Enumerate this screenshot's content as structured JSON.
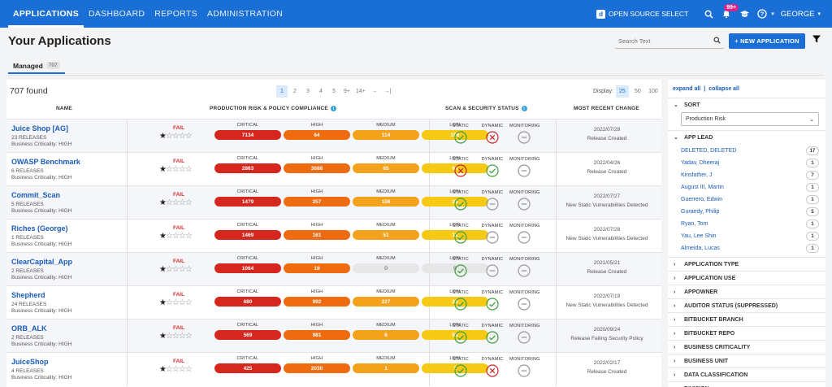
{
  "nav": {
    "items": [
      "APPLICATIONS",
      "DASHBOARD",
      "REPORTS",
      "ADMINISTRATION"
    ],
    "open_source_select": "OPEN SOURCE SELECT",
    "notifications_badge": "99+",
    "user": "GEORGE"
  },
  "header": {
    "title": "Your Applications",
    "search_placeholder": "Search Text",
    "new_app_label": "+ NEW APPLICATION",
    "tab_label": "Managed",
    "tab_count": "707"
  },
  "list": {
    "found": "707 found",
    "pages": [
      "1",
      "2",
      "3",
      "4",
      "5",
      "9+",
      "14+",
      "→",
      "→|"
    ],
    "display_label": "Display:",
    "display_options": [
      "25",
      "50",
      "100"
    ],
    "columns": {
      "name": "NAME",
      "risk": "PRODUCTION RISK & POLICY COMPLIANCE",
      "scan": "SCAN & SECURITY STATUS",
      "change": "MOST RECENT CHANGE"
    },
    "severity_labels": [
      "CRITICAL",
      "HIGH",
      "MEDIUM",
      "LOW"
    ],
    "scan_labels": [
      "STATIC",
      "DYNAMIC",
      "MONITORING"
    ],
    "rows": [
      {
        "name": "Juice Shop [AG]",
        "releases": "23 RELEASES",
        "criticality": "Business Criticality: HIGH",
        "status": "FAIL",
        "stars": 1,
        "counts": [
          "7134",
          "64",
          "114",
          "156"
        ],
        "scans": [
          "pass",
          "fail",
          "none"
        ],
        "date": "2022/07/28",
        "change": "Release Created"
      },
      {
        "name": "OWASP Benchmark",
        "releases": "6 RELEASES",
        "criticality": "Business Criticality: HIGH",
        "status": "FAIL",
        "stars": 1,
        "counts": [
          "2863",
          "3688",
          "65",
          "64"
        ],
        "scans": [
          "fail",
          "pass",
          "none"
        ],
        "date": "2022/04/26",
        "change": "Release Created"
      },
      {
        "name": "Commit_Scan",
        "releases": "5 RELEASES",
        "criticality": "Business Criticality: HIGH",
        "status": "FAIL",
        "stars": 1,
        "counts": [
          "1479",
          "257",
          "106",
          "26"
        ],
        "scans": [
          "pass",
          "none",
          "none"
        ],
        "date": "2022/07/27",
        "change": "New Static Vulnerabilities Detected"
      },
      {
        "name": "Riches (George)",
        "releases": "1 RELEASES",
        "criticality": "Business Criticality: HIGH",
        "status": "FAIL",
        "stars": 1,
        "counts": [
          "1469",
          "161",
          "51",
          "11"
        ],
        "scans": [
          "pass",
          "none",
          "none"
        ],
        "date": "2022/07/28",
        "change": "New Static Vulnerabilities Detected"
      },
      {
        "name": "ClearCapital_App",
        "releases": "2 RELEASES",
        "criticality": "Business Criticality: HIGH",
        "status": "FAIL",
        "stars": 1,
        "counts": [
          "1064",
          "19",
          "0",
          "0"
        ],
        "scans": [
          "pass",
          "none",
          "none"
        ],
        "date": "2021/05/21",
        "change": "Release Created"
      },
      {
        "name": "Shepherd",
        "releases": "24 RELEASES",
        "criticality": "Business Criticality: HIGH",
        "status": "FAIL",
        "stars": 1,
        "counts": [
          "680",
          "992",
          "227",
          "20"
        ],
        "scans": [
          "pass",
          "pass",
          "none"
        ],
        "date": "2022/07/19",
        "change": "New Static Vulnerabilities Detected"
      },
      {
        "name": "ORB_ALK",
        "releases": "2 RELEASES",
        "criticality": "Business Criticality: HIGH",
        "status": "FAIL",
        "stars": 1,
        "counts": [
          "569",
          "981",
          "6",
          "56"
        ],
        "scans": [
          "pass",
          "pass",
          "none"
        ],
        "date": "2020/09/24",
        "change": "Release Failing Security Policy"
      },
      {
        "name": "JuiceShop",
        "releases": "4 RELEASES",
        "criticality": "Business Criticality: HIGH",
        "status": "FAIL",
        "stars": 1,
        "counts": [
          "425",
          "2030",
          "1",
          "1"
        ],
        "scans": [
          "pass",
          "fail",
          "none"
        ],
        "date": "2022/02/17",
        "change": "Release Created"
      }
    ]
  },
  "sidebar": {
    "expand_all": "expand all",
    "collapse_all": "collapse all",
    "sort_label": "SORT",
    "sort_value": "Production Risk",
    "app_lead_label": "APP LEAD",
    "leads": [
      {
        "name": "DELETED, DELETED",
        "count": "17"
      },
      {
        "name": "Yadav, Dheeraj",
        "count": "1"
      },
      {
        "name": "Kinsfather, J",
        "count": "7"
      },
      {
        "name": "August III, Martin",
        "count": "1"
      },
      {
        "name": "Guerrero, Edwin",
        "count": "1"
      },
      {
        "name": "Guraedy, Philip",
        "count": "5"
      },
      {
        "name": "Ryan, Tom",
        "count": "1"
      },
      {
        "name": "Yau, Lee Shin",
        "count": "1"
      },
      {
        "name": "Almeida, Lucas",
        "count": "1"
      }
    ],
    "facets": [
      "APPLICATION TYPE",
      "APPLICATION USE",
      "APPOWNER",
      "AUDITOR STATUS (SUPPRESSED)",
      "BITBUCKET BRANCH",
      "BITBUCKET REPO",
      "BUSINESS CRITICALITY",
      "BUSINESS UNIT",
      "DATA CLASSIFICATION",
      "DIVISION"
    ]
  },
  "colors": {
    "brand": "#1a6fd6",
    "critical": "#d6271e",
    "high": "#ef6b10",
    "medium": "#f4a11b",
    "low": "#f6c915",
    "pass": "#3f9e3f",
    "fail": "#c62828"
  }
}
